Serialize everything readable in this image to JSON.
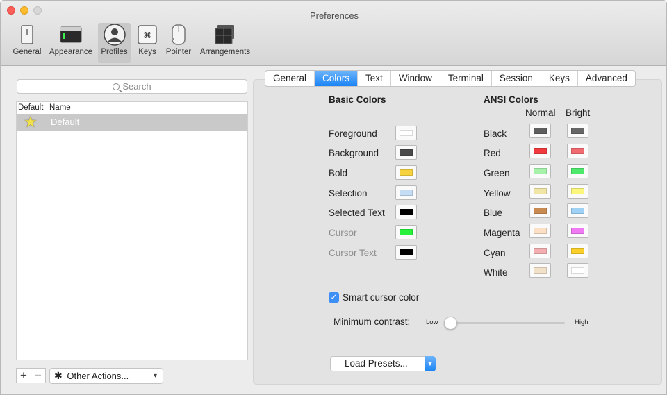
{
  "window": {
    "title": "Preferences"
  },
  "toolbar": {
    "items": [
      {
        "label": "General",
        "icon": "switch-icon"
      },
      {
        "label": "Appearance",
        "icon": "window-icon"
      },
      {
        "label": "Profiles",
        "icon": "person-icon",
        "selected": true
      },
      {
        "label": "Keys",
        "icon": "command-key-icon"
      },
      {
        "label": "Pointer",
        "icon": "mouse-icon"
      },
      {
        "label": "Arrangements",
        "icon": "window-stack-icon"
      }
    ]
  },
  "profiles": {
    "search_placeholder": "Search",
    "columns": {
      "default": "Default",
      "name": "Name"
    },
    "rows": [
      {
        "name": "Default",
        "is_default": true
      }
    ],
    "add_label": "+",
    "remove_label": "−",
    "other_actions_label": "Other Actions..."
  },
  "tabs": [
    {
      "label": "General"
    },
    {
      "label": "Colors",
      "active": true
    },
    {
      "label": "Text"
    },
    {
      "label": "Window"
    },
    {
      "label": "Terminal"
    },
    {
      "label": "Session"
    },
    {
      "label": "Keys"
    },
    {
      "label": "Advanced"
    }
  ],
  "basic_colors": {
    "title": "Basic Colors",
    "items": [
      {
        "label": "Foreground",
        "color": "#ffffff"
      },
      {
        "label": "Background",
        "color": "#4a4a4a"
      },
      {
        "label": "Bold",
        "color": "#f7d23f"
      },
      {
        "label": "Selection",
        "color": "#c4dcf4"
      },
      {
        "label": "Selected Text",
        "color": "#000000"
      },
      {
        "label": "Cursor",
        "color": "#27f13a",
        "disabled": true
      },
      {
        "label": "Cursor Text",
        "color": "#000000",
        "disabled": true
      }
    ]
  },
  "ansi_colors": {
    "title": "ANSI Colors",
    "normal_label": "Normal",
    "bright_label": "Bright",
    "items": [
      {
        "label": "Black",
        "normal": "#5e5e5e",
        "bright": "#666666"
      },
      {
        "label": "Red",
        "normal": "#f03a3e",
        "bright": "#f06a6f"
      },
      {
        "label": "Green",
        "normal": "#a6f2ab",
        "bright": "#4ee86a"
      },
      {
        "label": "Yellow",
        "normal": "#f1e5a5",
        "bright": "#fbf77c"
      },
      {
        "label": "Blue",
        "normal": "#c98a52",
        "bright": "#9fd1f5"
      },
      {
        "label": "Magenta",
        "normal": "#fbe0c5",
        "bright": "#f07af4"
      },
      {
        "label": "Cyan",
        "normal": "#f3aeb1",
        "bright": "#fbcf2a"
      },
      {
        "label": "White",
        "normal": "#f2e1c9",
        "bright": "#ffffff"
      }
    ]
  },
  "smart_cursor": {
    "label": "Smart cursor color",
    "checked": true
  },
  "minimum_contrast": {
    "label": "Minimum contrast:",
    "low": "Low",
    "high": "High",
    "value": 0
  },
  "load_presets_label": "Load Presets..."
}
